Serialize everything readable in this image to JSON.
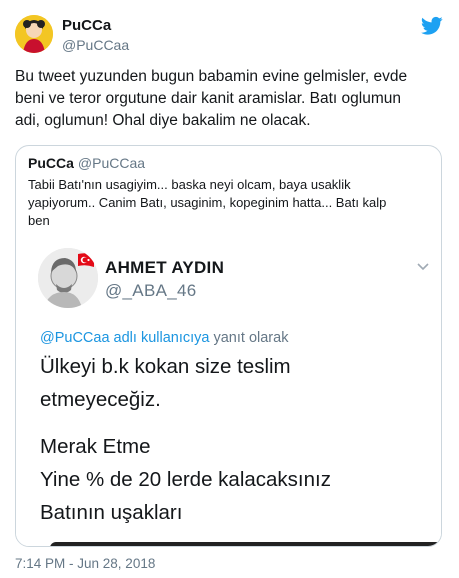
{
  "author": {
    "name": "PuCCa",
    "handle": "@PuCCaa"
  },
  "tweet": {
    "text_lines": [
      "Bu tweet yuzunden bugun babamin evine gelmisler, evde",
      "beni ve teror orgutune dair kanit aramislar. Batı oglumun",
      "adi, oglumun! Ohal diye bakalim ne olacak."
    ],
    "timestamp": "7:14 PM - Jun 28, 2018"
  },
  "quoted": {
    "name": "PuCCa",
    "handle": "@PuCCaa",
    "text_lines": [
      "Tabii Batı'nın usagiyim... baska neyi olcam, baya usaklik",
      "yapiyorum.. Canim Batı, usaginim, kopeginim hatta... Batı kalp",
      "ben"
    ]
  },
  "embedded": {
    "name": "AHMET AYDIN",
    "handle": "@_ABA_46",
    "reply_mention": "@PuCCaa adlı kullanıcıya",
    "reply_suffix": " yanıt olarak",
    "body_lines": [
      "Ülkeyi b.k kokan size teslim",
      "etmeyeceğiz."
    ],
    "body_lines_2": [
      "Merak Etme",
      "Yine % de 20 lerde kalacaksınız",
      "Batının uşakları"
    ]
  },
  "icons": {
    "logo": "twitter-bird-icon",
    "chevron": "chevron-down-icon",
    "flag": "turkish-flag-icon"
  },
  "colors": {
    "twitter_blue": "#1da1f2",
    "mention_blue": "#1b95e0",
    "secondary_text": "#657786",
    "flag_red": "#e30a17"
  }
}
